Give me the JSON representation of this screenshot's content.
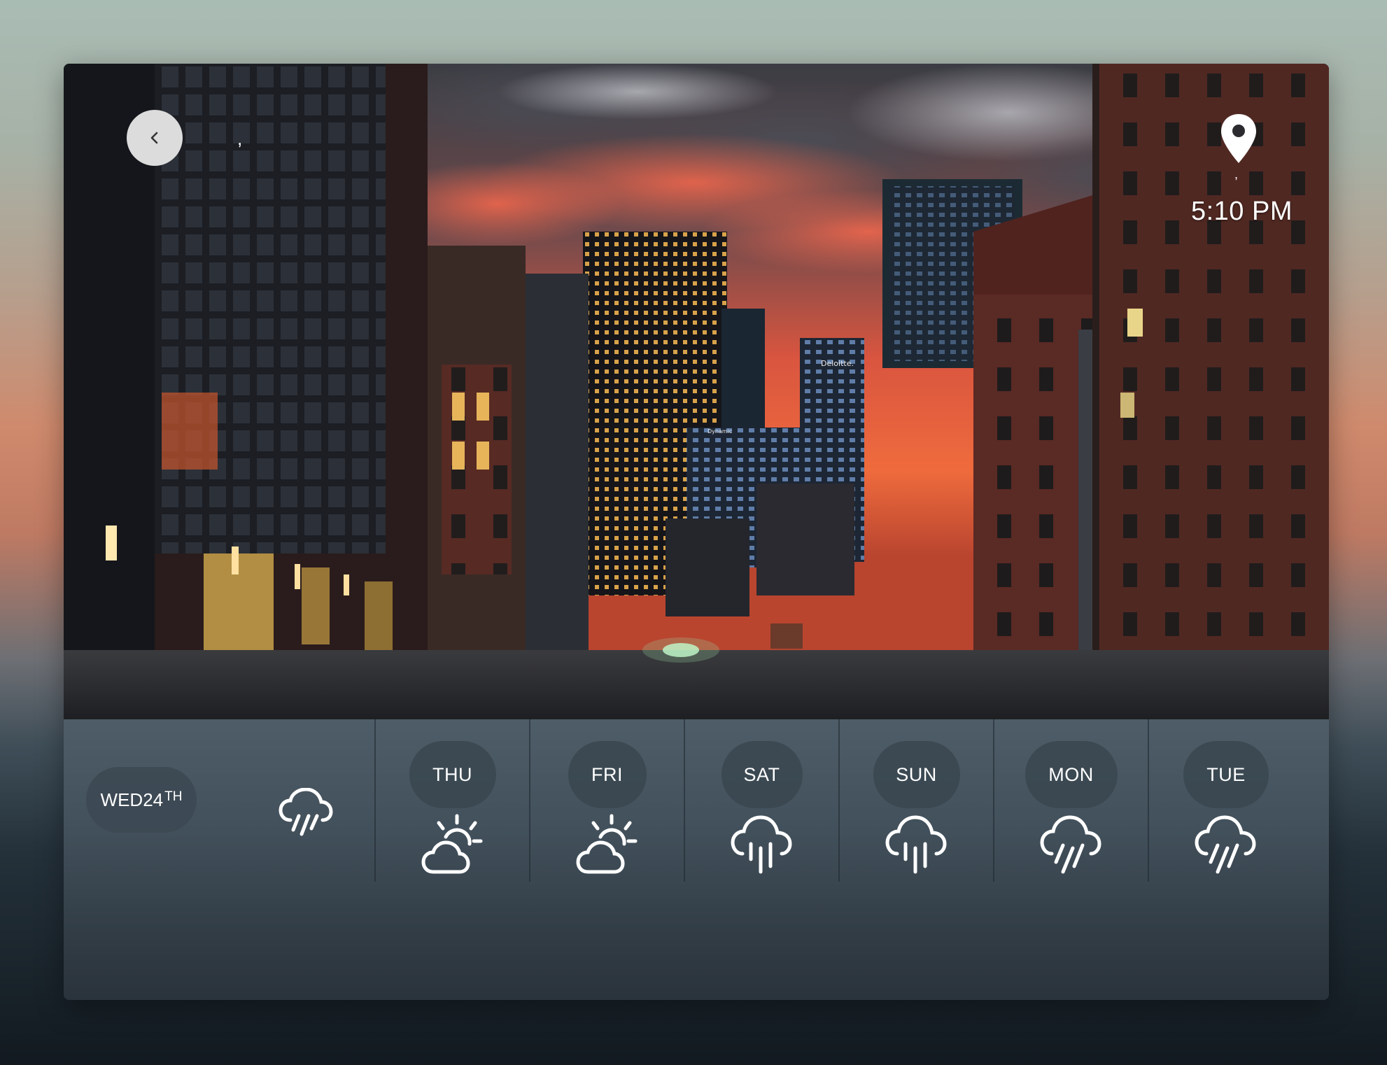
{
  "header": {
    "back_icon": "chevron-left-icon",
    "city_text": ",",
    "location_icon": "map-pin-icon",
    "location_text": ",",
    "time": "5:10 PM"
  },
  "photo": {
    "building_sign": "Deloitte.",
    "small_sign": "Dynamic"
  },
  "today": {
    "day_label": "WED24",
    "day_suffix": "TH",
    "icon": "rain-icon"
  },
  "forecast": [
    {
      "day": "THU",
      "icon": "partly-sunny-icon"
    },
    {
      "day": "FRI",
      "icon": "partly-sunny-icon"
    },
    {
      "day": "SAT",
      "icon": "rain-icon"
    },
    {
      "day": "SUN",
      "icon": "rain-icon"
    },
    {
      "day": "MON",
      "icon": "heavy-rain-icon"
    },
    {
      "day": "TUE",
      "icon": "heavy-rain-icon"
    }
  ]
}
